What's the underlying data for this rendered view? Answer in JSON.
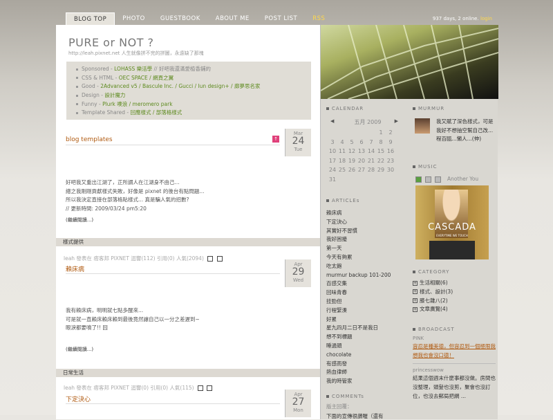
{
  "nav": {
    "items": [
      "BLOG TOP",
      "PHOTO",
      "GUESTBOOK",
      "ABOUT ME",
      "POST LIST",
      "RSS"
    ],
    "status": "937 days, 2 online.",
    "login": "login"
  },
  "blog": {
    "title": "PURE or NOT ?",
    "subtitle": "http://leah.pixnet.net 人生就像拼不完的拼圖，永遠缺了那塊",
    "links": [
      {
        "label": "Sponsored - ",
        "link": "LOHASS 樂活學",
        "rest": " // 好吧我還滿愛植香鋪的"
      },
      {
        "label": "CSS & HTML - ",
        "link": "OEC SPACE / 網頁之翼",
        "rest": ""
      },
      {
        "label": "Good - ",
        "link": "2Advanced v5 / Bascule Inc. / Gucci / lun design+ / 廊夢思名家",
        "rest": ""
      },
      {
        "label": "Design - ",
        "link": "設計魔力",
        "rest": ""
      },
      {
        "label": "Funny - ",
        "link": "Plurk 噗浪 / meromero park",
        "rest": ""
      },
      {
        "label": "Template Shared - ",
        "link": "回應樣式 / 部落格樣式",
        "rest": ""
      }
    ]
  },
  "posts": [
    {
      "title": "blog templates",
      "month": "Mar",
      "day": "24",
      "weekday": "Tue",
      "body": [
        "好吧我又重出江湖了，正所謂人在江湖身不由己...",
        "總之我剛剛貢獻樣式失敗，好像是 pixnet 的後台有點問題...",
        "所以我決定直接在部落格貼樣式... 真是騙人氣的招數?",
        "// 更新時間: 2009/03/24 pm5:20"
      ],
      "more": "(繼續閱讀...)",
      "meta": "leah 發表在 痞客邦 PIXNET 迴響(112) 引用(0) 人氣(2094)",
      "category": "樣式提供"
    },
    {
      "title": "賴床病",
      "month": "Apr",
      "day": "29",
      "weekday": "Wed",
      "body": [
        "我有賴床病，明明就七點多醒來...",
        "可是就一直賴床賴床賴到最後竟然讓自己以一分之差遲到~",
        "眼淚都要噴了!! 囧"
      ],
      "more": "(繼續閱讀...)",
      "meta": "leah 發表在 痞客邦 PIXNET 迴響(0) 引用(0) 人氣(115)",
      "category": "日常生活"
    },
    {
      "title": "下定決心",
      "month": "Apr",
      "day": "27",
      "weekday": "Mon"
    }
  ],
  "sidebar": {
    "calendar": {
      "title": "CALENDAR",
      "month": "五月 2009",
      "prev": "◀",
      "next": "▶",
      "rows": [
        [
          "",
          "",
          "",
          "",
          "",
          "1",
          "2"
        ],
        [
          "3",
          "4",
          "5",
          "6",
          "7",
          "8",
          "9"
        ],
        [
          "10",
          "11",
          "12",
          "13",
          "14",
          "15",
          "16"
        ],
        [
          "17",
          "18",
          "19",
          "20",
          "21",
          "22",
          "23"
        ],
        [
          "24",
          "25",
          "26",
          "27",
          "28",
          "29",
          "30"
        ],
        [
          "31",
          "",
          "",
          "",
          "",
          "",
          ""
        ]
      ]
    },
    "articles": {
      "title": "ARTICLEs",
      "items": [
        "賴床病",
        "下定決心",
        "其實好不習慣",
        "我好困擾",
        "第一天",
        "今天有夠累",
        "吃太飽",
        "murmur backup 101-200",
        "百感交集",
        "回味青春",
        "挂勁但",
        "行程緊湊",
        "好累",
        "星九四月二日不是我日",
        "想不到標題",
        "睡過頭",
        "chocolate",
        "有感而發",
        "熱血律師",
        "我的時管家"
      ]
    },
    "comments": {
      "title": "COMMENTs",
      "sub1": "版主回覆：",
      "sub2": "下面的宣傳很讚喔（還有"
    },
    "murmur": {
      "title": "MURMUR",
      "text": "我又賦了深色樣式，可是我好不想抽空幫自己改...程百甌...懶人...(伸)"
    },
    "music": {
      "title": "MUSIC",
      "track": "Another You",
      "album_title": "CASCADA",
      "album_sub": "EVERYTIME WE TOUCH"
    },
    "category": {
      "title": "CATEGORY",
      "items": [
        "生活相關(6)",
        "樣式、設計(3)",
        "膝七雜八(2)",
        "文章廣覽(4)"
      ]
    },
    "broadcast": {
      "title": "BROADCAST",
      "entries": [
        {
          "name": "PINK",
          "text": "容忍是種美德，但容忍到一個極限我想我也會沒口德！",
          "link": true
        },
        {
          "name": "princesswow",
          "text": "結果這個週末什麼事都沒做。房間也沒整理，頭髮也沒剪，聚會也沒訂位，也沒去郵局把網 ...",
          "link": false
        }
      ]
    }
  }
}
